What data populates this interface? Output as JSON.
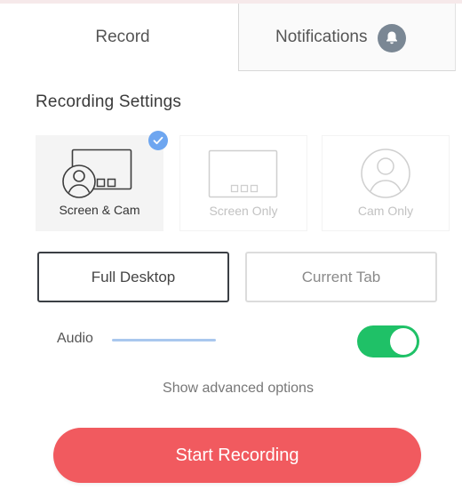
{
  "tabs": {
    "record_label": "Record",
    "notifications_label": "Notifications",
    "notifications_icon": "bell-icon"
  },
  "settings": {
    "title": "Recording Settings",
    "modes": [
      {
        "label": "Screen & Cam",
        "icon": "screen-cam-icon",
        "selected": true
      },
      {
        "label": "Screen Only",
        "icon": "screen-only-icon",
        "selected": false
      },
      {
        "label": "Cam Only",
        "icon": "cam-only-icon",
        "selected": false
      }
    ],
    "selected_badge_icon": "check-icon",
    "sources": {
      "full_desktop_label": "Full Desktop",
      "current_tab_label": "Current Tab",
      "selected": "Full Desktop"
    },
    "audio": {
      "label": "Audio",
      "enabled": true
    },
    "advanced_label": "Show advanced options",
    "start_label": "Start Recording"
  },
  "colors": {
    "accent_red": "#f15a5f",
    "toggle_green": "#1fc167",
    "check_blue": "#6ea6f0",
    "meter_blue": "#a9c7ee",
    "badge_gray": "#7a8794"
  }
}
